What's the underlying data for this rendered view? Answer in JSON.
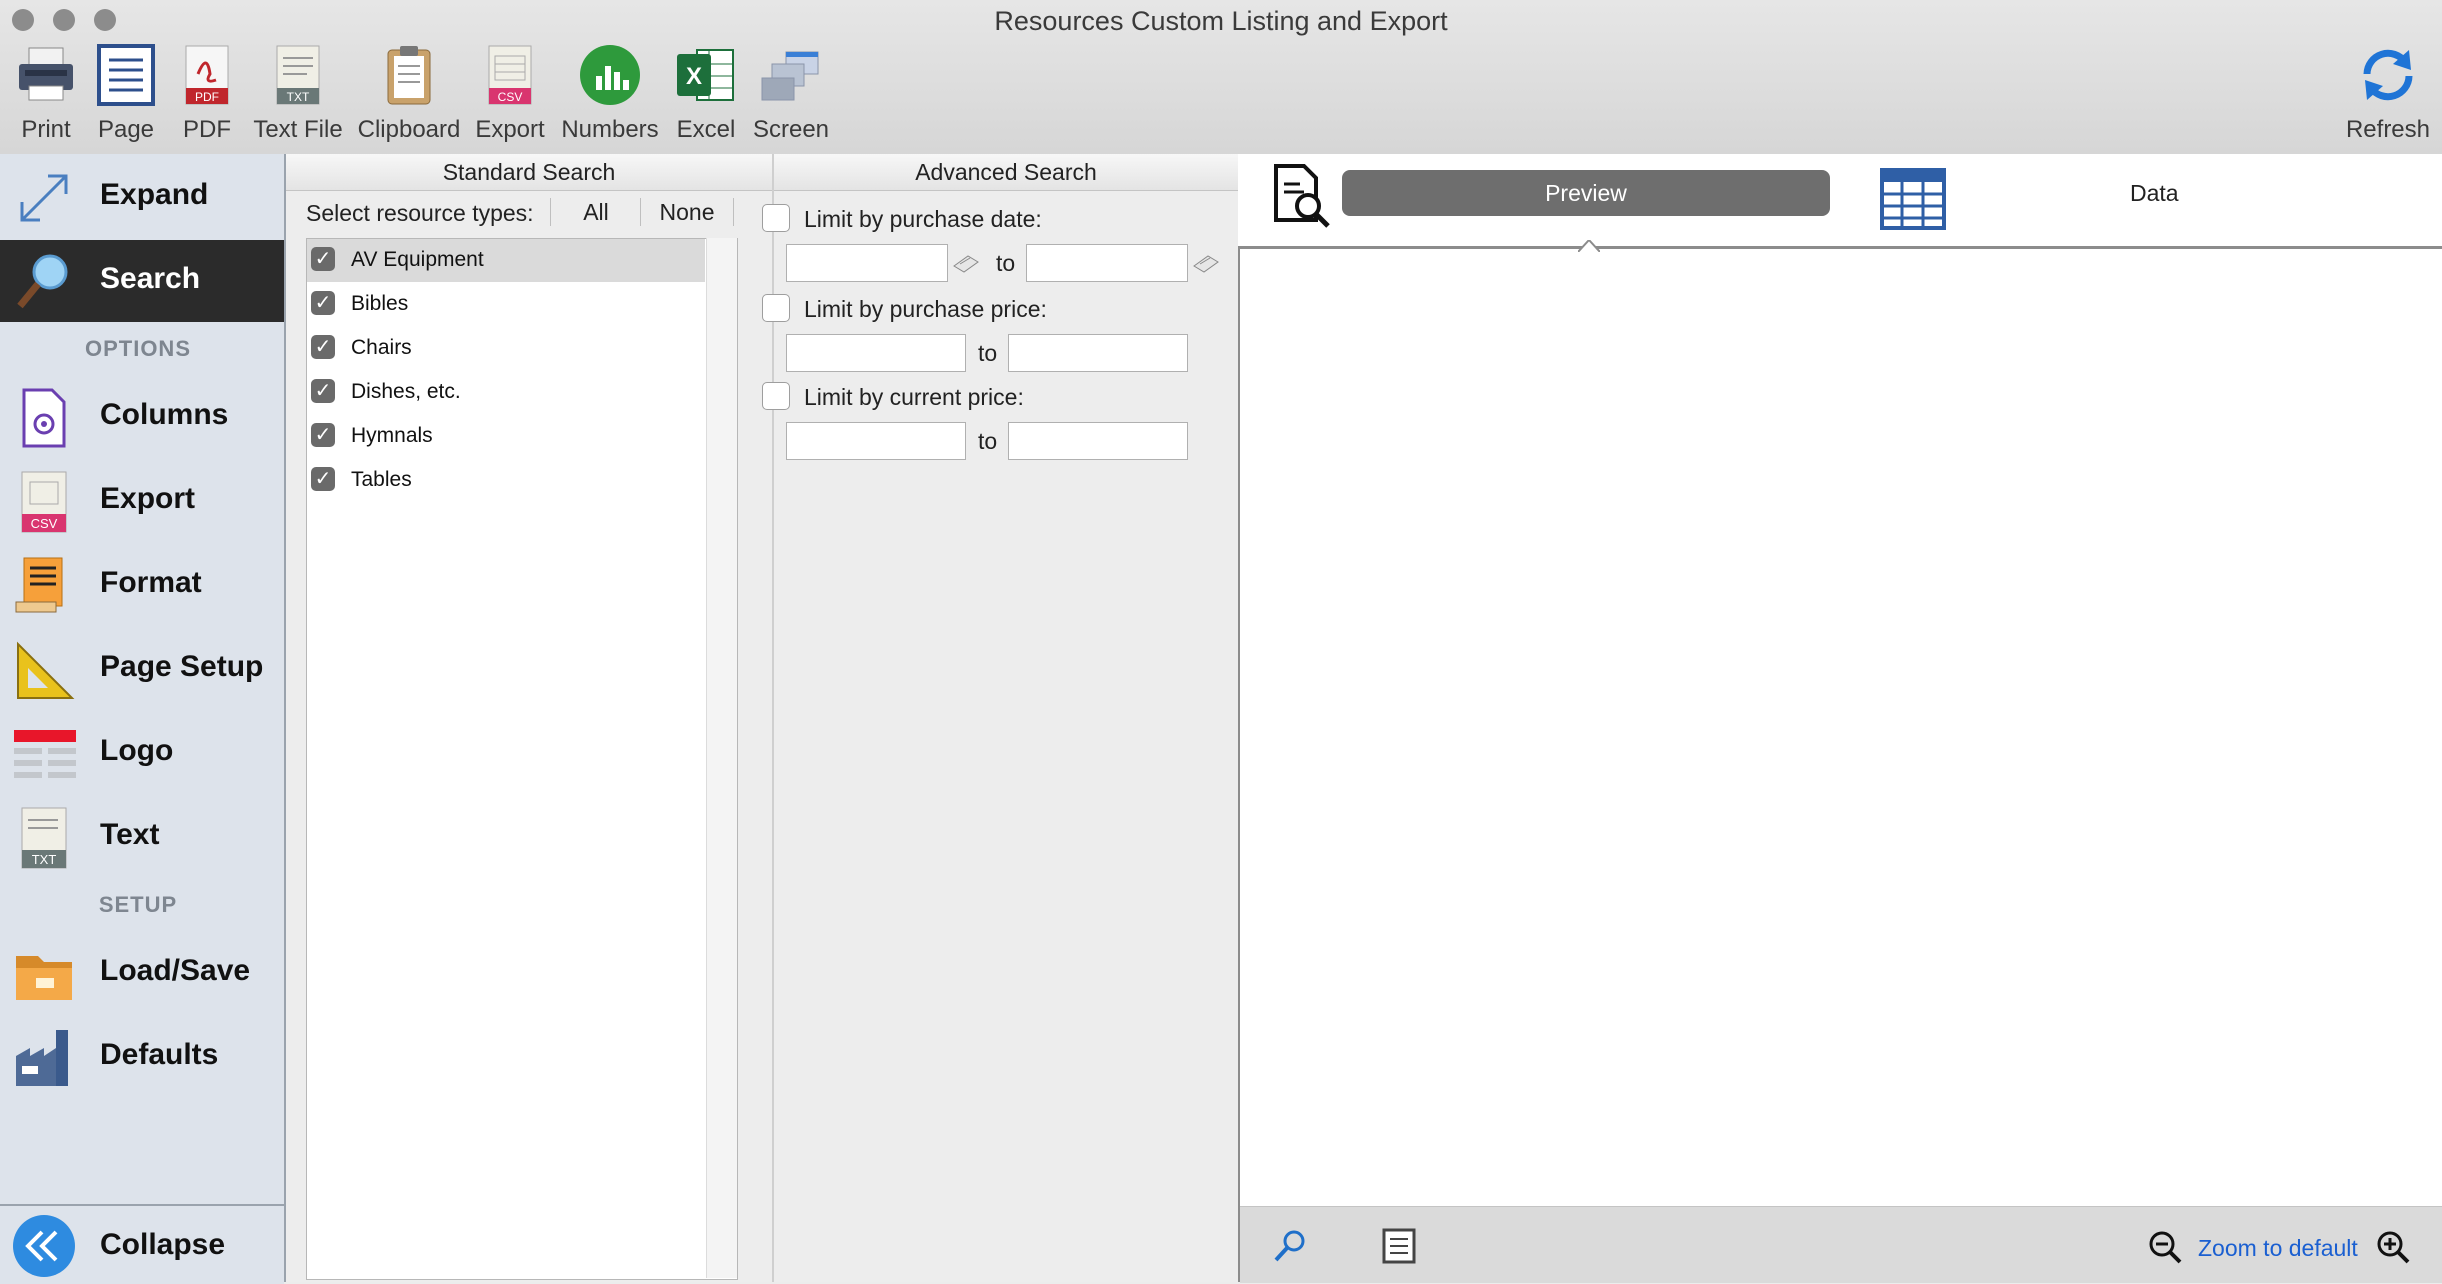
{
  "window": {
    "title": "Resources Custom Listing and Export"
  },
  "toolbar": {
    "items": [
      {
        "label": "Print",
        "icon": "printer-icon"
      },
      {
        "label": "Page",
        "icon": "page-icon"
      },
      {
        "label": "PDF",
        "icon": "pdf-icon"
      },
      {
        "label": "Text File",
        "icon": "text-file-icon"
      },
      {
        "label": "Clipboard",
        "icon": "clipboard-icon"
      },
      {
        "label": "Export",
        "icon": "csv-export-icon"
      },
      {
        "label": "Numbers",
        "icon": "numbers-icon"
      },
      {
        "label": "Excel",
        "icon": "excel-icon"
      },
      {
        "label": "Screen",
        "icon": "screen-icon"
      }
    ],
    "refresh": {
      "label": "Refresh",
      "icon": "refresh-icon"
    },
    "badges": {
      "pdf": "PDF",
      "txt": "TXT",
      "csv": "CSV",
      "excel": "X"
    }
  },
  "sidebar": {
    "expand": "Expand",
    "search": "Search",
    "options_header": "OPTIONS",
    "options": [
      "Columns",
      "Export",
      "Format",
      "Page Setup",
      "Logo",
      "Text"
    ],
    "setup_header": "SETUP",
    "setup": [
      "Load/Save",
      "Defaults"
    ],
    "collapse": "Collapse",
    "badges": {
      "csv": "CSV",
      "txt": "TXT"
    }
  },
  "standard_search": {
    "tab": "Standard Search",
    "select_label": "Select resource types:",
    "all": "All",
    "none": "None",
    "types": [
      {
        "label": "AV Equipment",
        "checked": true,
        "selected": true
      },
      {
        "label": "Bibles",
        "checked": true
      },
      {
        "label": "Chairs",
        "checked": true
      },
      {
        "label": "Dishes, etc.",
        "checked": true
      },
      {
        "label": "Hymnals",
        "checked": true
      },
      {
        "label": "Tables",
        "checked": true
      }
    ]
  },
  "advanced_search": {
    "tab": "Advanced Search",
    "purchase_date": "Limit by purchase date:",
    "purchase_price": "Limit by purchase price:",
    "current_price": "Limit by current price:",
    "to": "to"
  },
  "preview_panel": {
    "preview": "Preview",
    "data": "Data",
    "zoom_default": "Zoom to default"
  },
  "colors": {
    "accent_blue": "#1a5fd1",
    "sidebar_bg": "#dde3eb",
    "search_bg": "#2b2b2b",
    "numbers_green": "#2e9a3c",
    "excel_green": "#1d6f3b"
  }
}
